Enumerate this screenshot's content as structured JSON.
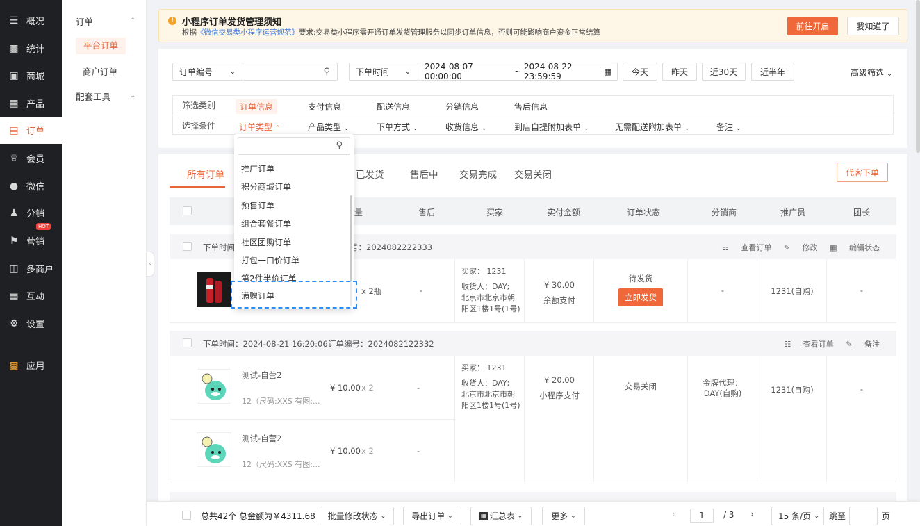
{
  "sidebar": {
    "items": [
      {
        "label": "概况",
        "icon": "layers-icon"
      },
      {
        "label": "统计",
        "icon": "chart-icon"
      },
      {
        "label": "商城",
        "icon": "store-icon"
      },
      {
        "label": "产品",
        "icon": "grid-icon"
      },
      {
        "label": "订单",
        "icon": "clipboard-icon"
      },
      {
        "label": "会员",
        "icon": "crown-icon"
      },
      {
        "label": "微信",
        "icon": "wechat-icon"
      },
      {
        "label": "分销",
        "icon": "users-icon"
      },
      {
        "label": "营销",
        "icon": "flag-icon",
        "badge": "HOT"
      },
      {
        "label": "多商户",
        "icon": "shop-icon"
      },
      {
        "label": "互动",
        "icon": "apps-icon"
      },
      {
        "label": "设置",
        "icon": "gear-icon"
      },
      {
        "label": "应用",
        "icon": "app-grid-icon"
      }
    ]
  },
  "submenu": {
    "group1": "订单",
    "item1": "平台订单",
    "item2": "商户订单",
    "group2": "配套工具"
  },
  "notice": {
    "title": "小程序订单发货管理须知",
    "text_prefix": "根据",
    "link": "《微信交易类小程序运营规范》",
    "text_suffix": "要求:交易类小程序需开通订单发货管理服务以同步订单信息，否则可能影响商户资金正常结算",
    "btn_open": "前往开启",
    "btn_ack": "我知道了"
  },
  "filter": {
    "field_select": "订单编号",
    "time_select": "下单时间",
    "date_start": "2024-08-07 00:00:00",
    "date_sep": "~",
    "date_end": "2024-08-22 23:59:59",
    "quick": [
      "今天",
      "昨天",
      "近30天",
      "近半年"
    ],
    "advanced": "高级筛选",
    "row1_label": "筛选类别",
    "categories": [
      "订单信息",
      "支付信息",
      "配送信息",
      "分销信息",
      "售后信息"
    ],
    "row2_label": "选择条件",
    "conditions": [
      "订单类型",
      "产品类型",
      "下单方式",
      "收货信息",
      "到店自提附加表单",
      "无需配送附加表单",
      "备注"
    ]
  },
  "dropdown": {
    "items": [
      "推广订单",
      "积分商城订单",
      "预售订单",
      "组合套餐订单",
      "社区团购订单",
      "打包一口价订单",
      "第2件半价订单",
      "满赠订单"
    ]
  },
  "tabs": [
    "所有订单",
    "已发货",
    "售后中",
    "交易完成",
    "交易关闭"
  ],
  "proxy_order": "代客下单",
  "columns": [
    "/数量",
    "售后",
    "买家",
    "实付金额",
    "订单状态",
    "分销商",
    "推广员",
    "团长"
  ],
  "orders": [
    {
      "time_label": "下单时间",
      "no_label": "号：2024082222333",
      "actions": [
        "查看订单",
        "修改",
        "编辑状态"
      ],
      "qty": "x 2瓶",
      "aftersale": "-",
      "buyer": "买家：  1231",
      "receiver": "收货人：DAY;",
      "addr1": "北京市北京市朝",
      "addr2": "阳区1楼1号(1号)",
      "amount": "¥ 30.00",
      "pay": "余额支付",
      "status": "待发货",
      "ship": "立即发货",
      "distributor": "-",
      "promoter": "1231(自购)",
      "leader": "-"
    },
    {
      "time": "下单时间：2024-08-21 16:20:06",
      "no": "订单编号：2024082122332",
      "actions": [
        "查看订单",
        "备注"
      ],
      "items": [
        {
          "name": "测试-自营2",
          "spec": "12（尺码:XXS 有图:...",
          "price": "¥ 10.00",
          "qty": "x 2",
          "aftersale": "-"
        },
        {
          "name": "测试-自营2",
          "spec": "12（尺码:XXS 有图:...",
          "price": "¥ 10.00",
          "qty": "x 2",
          "aftersale": "-"
        }
      ],
      "buyer": "买家：  1231",
      "receiver": "收货人：DAY;",
      "addr1": "北京市北京市朝",
      "addr2": "阳区1楼1号(1号)",
      "amount": "¥ 20.00",
      "pay": "小程序支付",
      "status": "交易关闭",
      "distributor1": "金牌代理：",
      "distributor2": "DAY(自购)",
      "promoter": "1231(自购)",
      "leader": "-"
    }
  ],
  "footer": {
    "summary": "总共42个  总金额为￥4311.68",
    "batch": "批量修改状态",
    "export": "导出订单",
    "report": "汇总表",
    "more": "更多",
    "page": "1",
    "total_pages": "/  3",
    "page_size": "15 条/页",
    "jump": "跳至",
    "page_unit": "页"
  },
  "colors": {
    "accent": "#f0673a",
    "sidebar": "#1f2023"
  }
}
